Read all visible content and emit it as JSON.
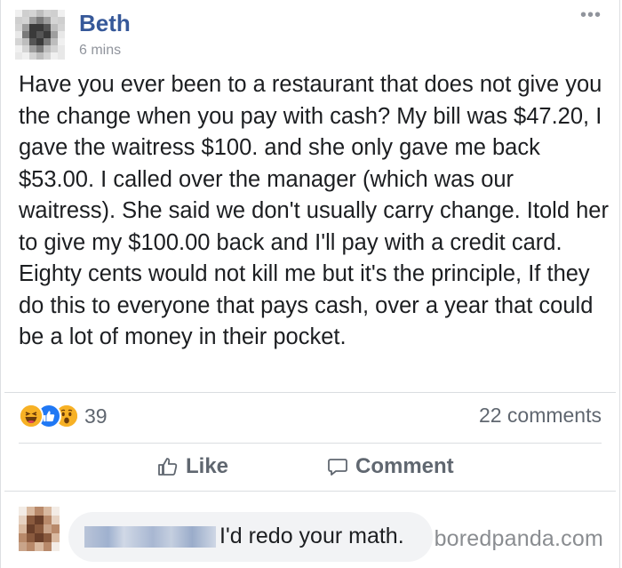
{
  "post": {
    "author": "Beth",
    "time": "6 mins",
    "more_label": "•••",
    "text": "Have you ever been to a restaurant that does not give you the change when you pay with cash? My bill was $47.20, I gave the waitress $100. and she only gave me back $53.00. I called over the manager (which was our waitress). She said we don't usually carry change. Itold her to give my $100.00 back and I'll pay with a credit card. Eighty cents would not kill me but it's the principle, If they do this to everyone that pays cash, over a year that could be a lot of money in their pocket."
  },
  "stats": {
    "reaction_icons": [
      "haha-icon",
      "like-icon",
      "wow-icon"
    ],
    "reaction_count": "39",
    "comments_count": "22 comments"
  },
  "actions": {
    "like_label": "Like",
    "comment_label": "Comment"
  },
  "comment": {
    "text": "I'd redo your math."
  },
  "watermark": "boredpanda.com",
  "colors": {
    "author": "#365899",
    "like_blue": "#2078f4",
    "emoji_yellow": "#f7b125",
    "muted": "#606770",
    "bubble": "#f2f3f5"
  }
}
